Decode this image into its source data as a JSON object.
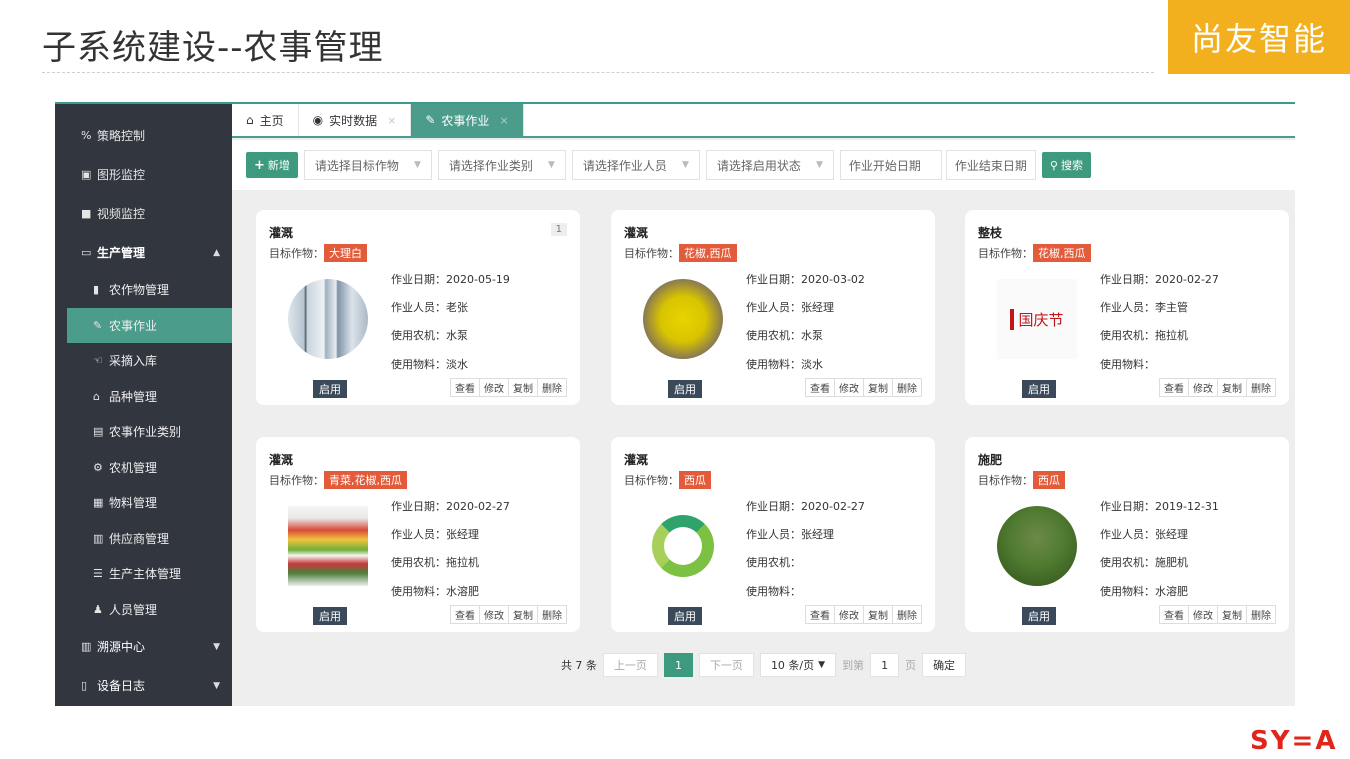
{
  "slide": {
    "title": "子系统建设--农事管理",
    "brand": "尚友智能",
    "logo_text": "SY=A"
  },
  "sidebar": {
    "items": [
      {
        "label": "策略控制",
        "icon": "percent-icon"
      },
      {
        "label": "图形监控",
        "icon": "image-icon"
      },
      {
        "label": "视频监控",
        "icon": "video-icon"
      },
      {
        "label": "生产管理",
        "icon": "window-icon",
        "expanded": true
      },
      {
        "label": "农作物管理",
        "icon": "bookmark-icon"
      },
      {
        "label": "农事作业",
        "icon": "edit-icon",
        "active": true
      },
      {
        "label": "采摘入库",
        "icon": "hand-icon"
      },
      {
        "label": "品种管理",
        "icon": "lock-icon"
      },
      {
        "label": "农事作业类别",
        "icon": "list-icon"
      },
      {
        "label": "农机管理",
        "icon": "cogs-icon"
      },
      {
        "label": "物料管理",
        "icon": "archive-icon"
      },
      {
        "label": "供应商管理",
        "icon": "card-icon"
      },
      {
        "label": "生产主体管理",
        "icon": "list-alt-icon"
      },
      {
        "label": "人员管理",
        "icon": "user-icon"
      },
      {
        "label": "溯源中心",
        "icon": "card-icon"
      },
      {
        "label": "设备日志",
        "icon": "file-icon"
      }
    ]
  },
  "tabs": [
    {
      "label": "主页",
      "icon": "home-icon"
    },
    {
      "label": "实时数据",
      "icon": "target-icon",
      "close": "×"
    },
    {
      "label": "农事作业",
      "icon": "edit-icon",
      "close": "×",
      "active": true
    }
  ],
  "toolbar": {
    "add_label": "新增",
    "filters": [
      "请选择目标作物",
      "请选择作业类别",
      "请选择作业人员",
      "请选择启用状态"
    ],
    "start_date_placeholder": "作业开始日期",
    "end_date_placeholder": "作业结束日期",
    "search_label": "搜索"
  },
  "cards": [
    {
      "title": "灌溉",
      "badge": "1",
      "target_label": "目标作物：",
      "crop": "大理白",
      "date_label": "作业日期：",
      "date": "2020-05-19",
      "person_label": "作业人员：",
      "person": "老张",
      "machine_label": "使用农机：",
      "machine": "水泵",
      "material_label": "使用物料：",
      "material": "淡水",
      "status": "启用",
      "actions": [
        "查看",
        "修改",
        "复制",
        "删除"
      ]
    },
    {
      "title": "灌溉",
      "target_label": "目标作物：",
      "crop": "花椒,西瓜",
      "date_label": "作业日期：",
      "date": "2020-03-02",
      "person_label": "作业人员：",
      "person": "张经理",
      "machine_label": "使用农机：",
      "machine": "水泵",
      "material_label": "使用物料：",
      "material": "淡水",
      "status": "启用",
      "actions": [
        "查看",
        "修改",
        "复制",
        "删除"
      ]
    },
    {
      "title": "整枝",
      "target_label": "目标作物：",
      "crop": "花椒,西瓜",
      "date_label": "作业日期：",
      "date": "2020-02-27",
      "person_label": "作业人员：",
      "person": "李主管",
      "machine_label": "使用农机：",
      "machine": "拖拉机",
      "material_label": "使用物料：",
      "material": "",
      "status": "启用",
      "actions": [
        "查看",
        "修改",
        "复制",
        "删除"
      ],
      "photo_text": "国庆节"
    },
    {
      "title": "灌溉",
      "target_label": "目标作物：",
      "crop": "青菜,花椒,西瓜",
      "date_label": "作业日期：",
      "date": "2020-02-27",
      "person_label": "作业人员：",
      "person": "张经理",
      "machine_label": "使用农机：",
      "machine": "拖拉机",
      "material_label": "使用物料：",
      "material": "水溶肥",
      "status": "启用",
      "actions": [
        "查看",
        "修改",
        "复制",
        "删除"
      ]
    },
    {
      "title": "灌溉",
      "target_label": "目标作物：",
      "crop": "西瓜",
      "date_label": "作业日期：",
      "date": "2020-02-27",
      "person_label": "作业人员：",
      "person": "张经理",
      "machine_label": "使用农机：",
      "machine": "",
      "material_label": "使用物料：",
      "material": "",
      "status": "启用",
      "actions": [
        "查看",
        "修改",
        "复制",
        "删除"
      ]
    },
    {
      "title": "施肥",
      "target_label": "目标作物：",
      "crop": "西瓜",
      "date_label": "作业日期：",
      "date": "2019-12-31",
      "person_label": "作业人员：",
      "person": "张经理",
      "machine_label": "使用农机：",
      "machine": "施肥机",
      "material_label": "使用物料：",
      "material": "水溶肥",
      "status": "启用",
      "actions": [
        "查看",
        "修改",
        "复制",
        "删除"
      ]
    }
  ],
  "pager": {
    "total": "共 7 条",
    "prev": "上一页",
    "current": "1",
    "next": "下一页",
    "per_page": "10 条/页",
    "goto": "到第",
    "goto_value": "1",
    "page_unit": "页",
    "confirm": "确定"
  },
  "colors": {
    "accent": "#3d9a7e",
    "sidebar_bg": "#32363f",
    "brand": "#f2b01e",
    "crop_tag": "#e25b3a"
  }
}
